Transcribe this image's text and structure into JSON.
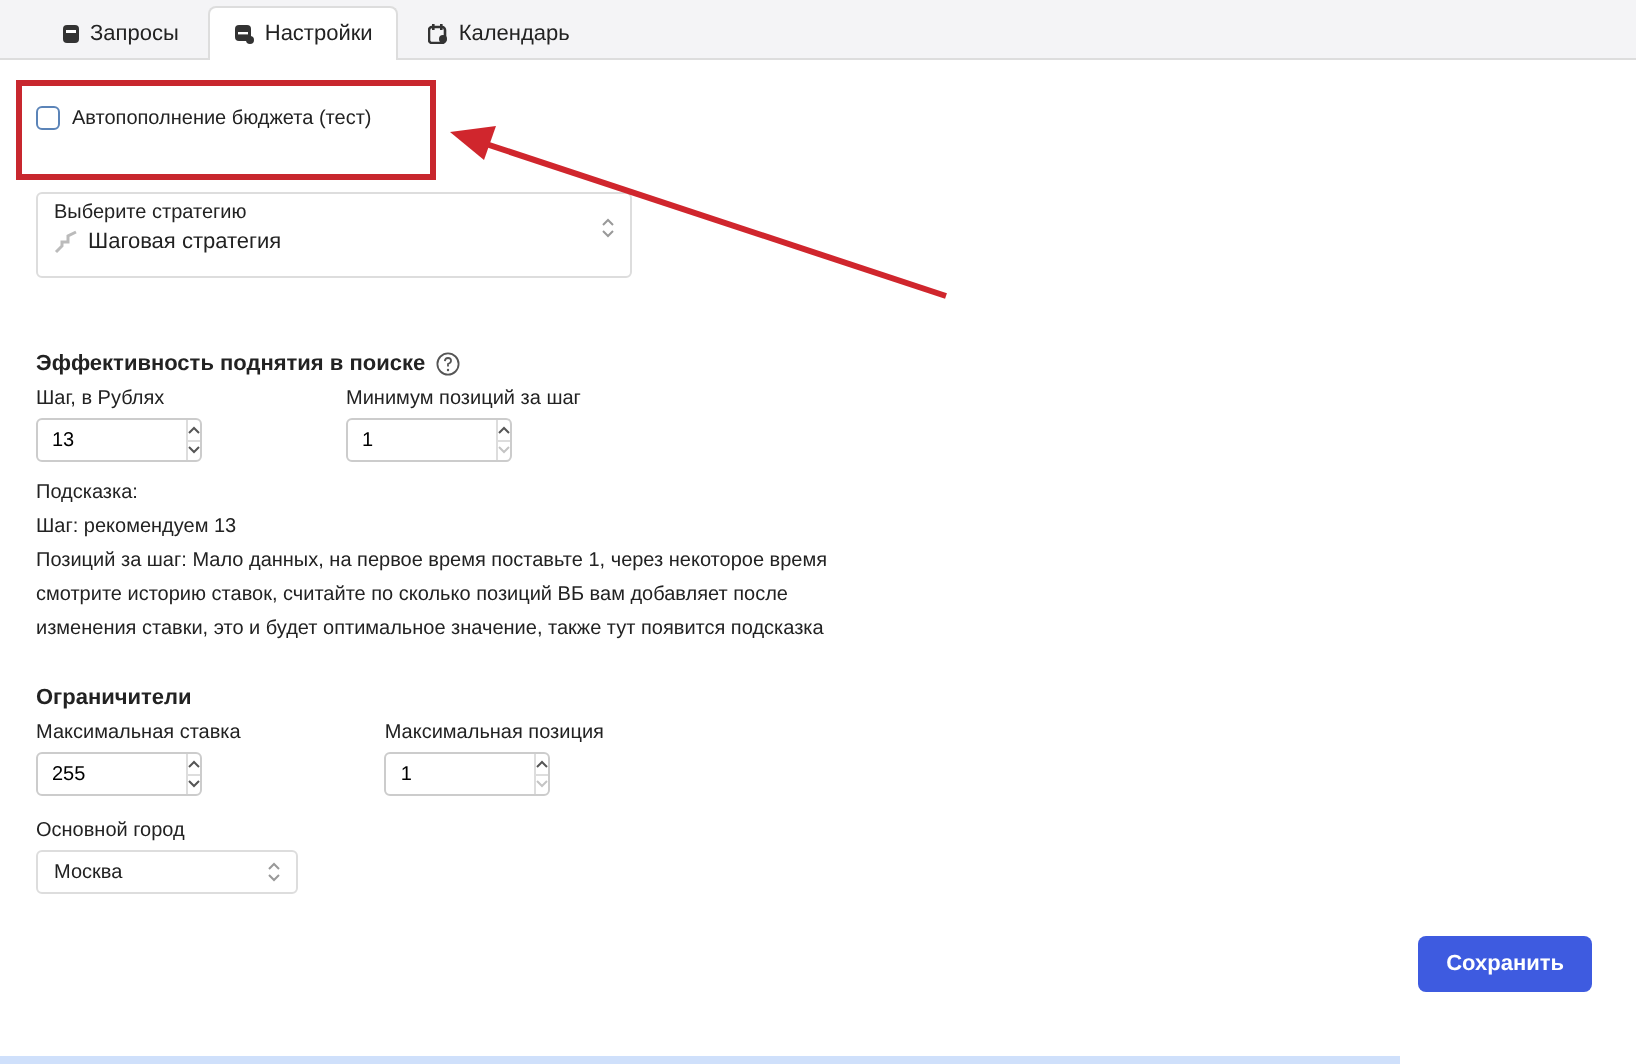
{
  "tabs": [
    {
      "label": "Запросы",
      "kind": "db",
      "selected": false
    },
    {
      "label": "Настройки",
      "kind": "gear",
      "selected": true
    },
    {
      "label": "Календарь",
      "kind": "calendar",
      "selected": false
    }
  ],
  "autofill": {
    "label": "Автопополнение бюджета (тест)",
    "checked": false
  },
  "strategy": {
    "label": "Выберите стратегию",
    "value": "Шаговая стратегия"
  },
  "efficiency": {
    "title": "Эффективность поднятия в поиске",
    "fields": [
      {
        "label": "Шаг, в Рублях",
        "value": "13",
        "down_disabled": false
      },
      {
        "label": "Минимум позиций за шаг",
        "value": "1",
        "down_disabled": true
      }
    ],
    "hint": [
      "Подсказка:",
      "Шаг: рекомендуем 13",
      "Позиций за шаг: Мало данных, на первое время поставьте 1, через некоторое время смотрите историю ставок, считайте по сколько позиций ВБ вам добавляет после изменения ставки, это и будет оптимальное значение, также тут появится подсказка"
    ]
  },
  "limits": {
    "title": "Ограничители",
    "fields": [
      {
        "label": "Максимальная ставка",
        "value": "255",
        "down_disabled": false
      },
      {
        "label": "Максимальная позиция",
        "value": "1",
        "down_disabled": true
      }
    ],
    "city": {
      "label": "Основной город",
      "value": "Москва"
    }
  },
  "save_button": "Сохранить"
}
